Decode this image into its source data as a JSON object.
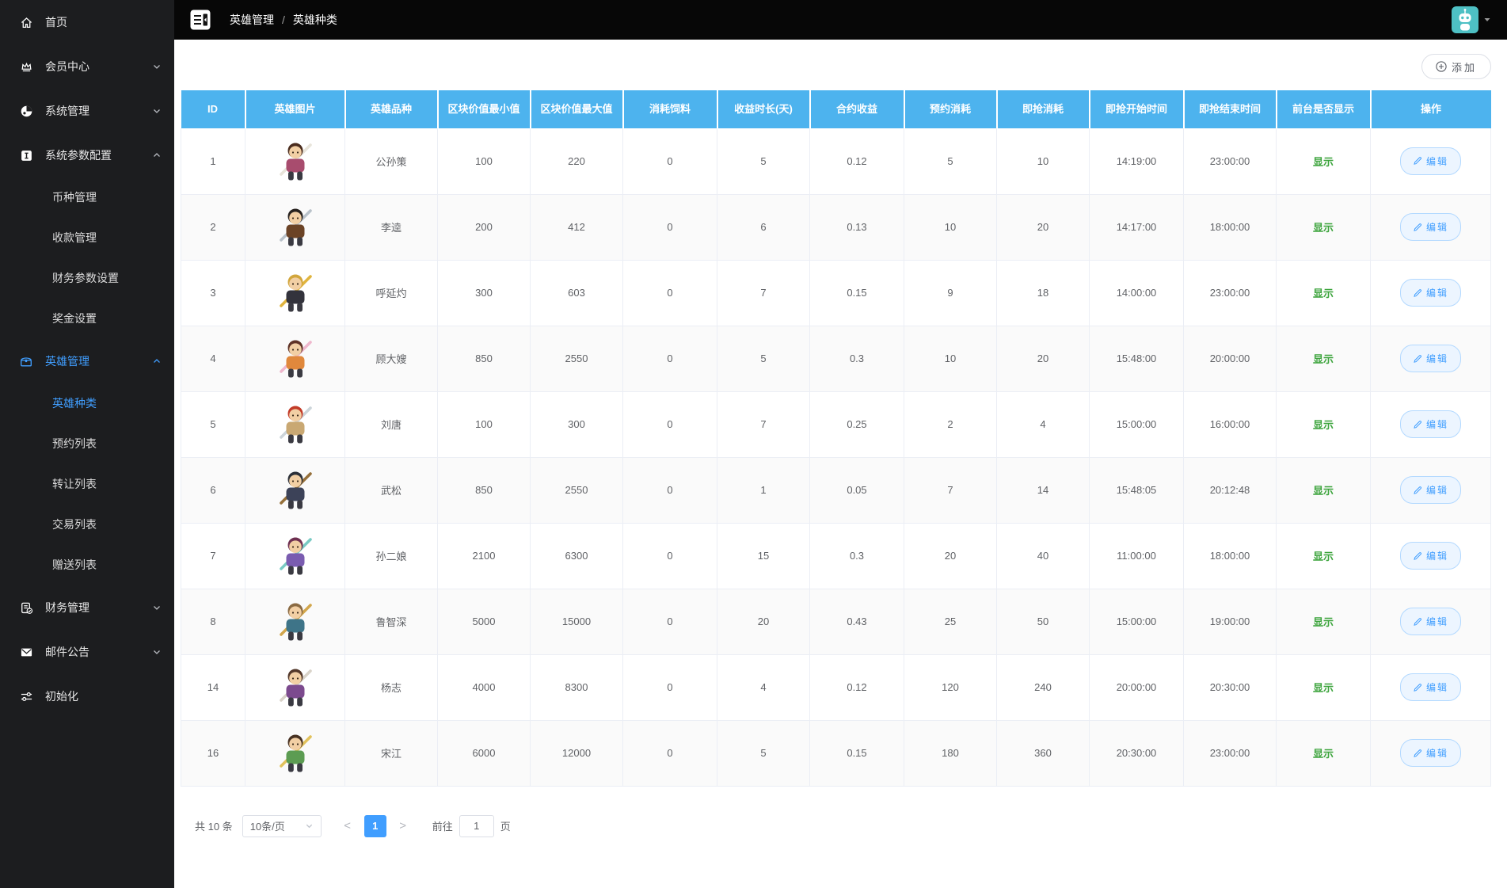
{
  "colors": {
    "accent": "#409EFF",
    "table_header_blue": "#4db3ee",
    "success_green": "#3aa33a",
    "sidebar_bg": "#1c1d1f",
    "topbar_bg": "#070707",
    "avatar_teal": "#4ec0c4",
    "edit_btn_bg": "#ecf5ff",
    "edit_btn_border": "#b3d9ff"
  },
  "sidebar": {
    "items": [
      {
        "label": "首页",
        "icon": "home-icon"
      },
      {
        "label": "会员中心",
        "icon": "crown-icon",
        "chevron": "down"
      },
      {
        "label": "系统管理",
        "icon": "globe-icon",
        "chevron": "down"
      },
      {
        "label": "系统参数配置",
        "icon": "info-square-icon",
        "chevron": "up",
        "children": [
          {
            "label": "币种管理"
          },
          {
            "label": "收款管理"
          },
          {
            "label": "财务参数设置"
          },
          {
            "label": "奖金设置"
          }
        ]
      },
      {
        "label": "英雄管理",
        "icon": "chest-icon",
        "chevron": "up",
        "active": true,
        "children": [
          {
            "label": "英雄种类",
            "active": true
          },
          {
            "label": "预约列表"
          },
          {
            "label": "转让列表"
          },
          {
            "label": "交易列表"
          },
          {
            "label": "赠送列表"
          }
        ]
      },
      {
        "label": "财务管理",
        "icon": "finance-doc-icon",
        "chevron": "down"
      },
      {
        "label": "邮件公告",
        "icon": "mail-icon",
        "chevron": "down"
      },
      {
        "label": "初始化",
        "icon": "sliders-icon"
      }
    ]
  },
  "topbar": {
    "breadcrumb": [
      {
        "label": "英雄管理"
      },
      {
        "label": "英雄种类"
      }
    ],
    "separator": "/",
    "icons": [
      "menu-collapse-icon",
      "avatar",
      "caret-down-icon"
    ]
  },
  "toolbar": {
    "add_label": "添加",
    "add_icon": "plus-circle-icon"
  },
  "table": {
    "headers": [
      "ID",
      "英雄图片",
      "英雄品种",
      "区块价值最小值",
      "区块价值最大值",
      "消耗饲料",
      "收益时长(天)",
      "合约收益",
      "预约消耗",
      "即抢消耗",
      "即抢开始时间",
      "即抢结束时间",
      "前台是否显示",
      "操作"
    ],
    "labels": {
      "edit": "编辑",
      "edit_icon": "pencil-icon",
      "sprite_icon": "hero-sprite"
    },
    "rows": [
      {
        "id": 1,
        "name": "公孙策",
        "min": 100,
        "max": 220,
        "feed": 0,
        "days": 5,
        "profit": "0.12",
        "reserve": 5,
        "grab": 10,
        "start": "14:19:00",
        "end": "23:00:00",
        "visible": "显示",
        "sprite": {
          "hair": "#4a2c1e",
          "body": "#a84c6e",
          "weapon": "#e8e4da"
        }
      },
      {
        "id": 2,
        "name": "李逵",
        "min": 200,
        "max": 412,
        "feed": 0,
        "days": 6,
        "profit": "0.13",
        "reserve": 10,
        "grab": 20,
        "start": "14:17:00",
        "end": "18:00:00",
        "visible": "显示",
        "sprite": {
          "hair": "#26211e",
          "body": "#6b4326",
          "weapon": "#b9c2ca"
        }
      },
      {
        "id": 3,
        "name": "呼延灼",
        "min": 300,
        "max": 603,
        "feed": 0,
        "days": 7,
        "profit": "0.15",
        "reserve": 9,
        "grab": 18,
        "start": "14:00:00",
        "end": "23:00:00",
        "visible": "显示",
        "sprite": {
          "hair": "#d2a63c",
          "body": "#33333c",
          "weapon": "#e0b43e"
        }
      },
      {
        "id": 4,
        "name": "顾大嫂",
        "min": 850,
        "max": 2550,
        "feed": 0,
        "days": 5,
        "profit": "0.3",
        "reserve": 10,
        "grab": 20,
        "start": "15:48:00",
        "end": "20:00:00",
        "visible": "显示",
        "sprite": {
          "hair": "#5e3226",
          "body": "#e0883c",
          "weapon": "#efb7cd"
        }
      },
      {
        "id": 5,
        "name": "刘唐",
        "min": 100,
        "max": 300,
        "feed": 0,
        "days": 7,
        "profit": "0.25",
        "reserve": 2,
        "grab": 4,
        "start": "15:00:00",
        "end": "16:00:00",
        "visible": "显示",
        "sprite": {
          "hair": "#c23b28",
          "body": "#c9a873",
          "weapon": "#ccd4d9"
        }
      },
      {
        "id": 6,
        "name": "武松",
        "min": 850,
        "max": 2550,
        "feed": 0,
        "days": 1,
        "profit": "0.05",
        "reserve": 7,
        "grab": 14,
        "start": "15:48:05",
        "end": "20:12:48",
        "visible": "显示",
        "sprite": {
          "hair": "#2c3038",
          "body": "#3c4258",
          "weapon": "#96703a"
        }
      },
      {
        "id": 7,
        "name": "孙二娘",
        "min": 2100,
        "max": 6300,
        "feed": 0,
        "days": 15,
        "profit": "0.3",
        "reserve": 20,
        "grab": 40,
        "start": "11:00:00",
        "end": "18:00:00",
        "visible": "显示",
        "sprite": {
          "hair": "#6e2f50",
          "body": "#7a5cb0",
          "weapon": "#79cbc4"
        }
      },
      {
        "id": 8,
        "name": "鲁智深",
        "min": 5000,
        "max": 15000,
        "feed": 0,
        "days": 20,
        "profit": "0.43",
        "reserve": 25,
        "grab": 50,
        "start": "15:00:00",
        "end": "19:00:00",
        "visible": "显示",
        "sprite": {
          "hair": "#8a6a42",
          "body": "#3e7488",
          "weapon": "#d2a64c"
        }
      },
      {
        "id": 14,
        "name": "杨志",
        "min": 4000,
        "max": 8300,
        "feed": 0,
        "days": 4,
        "profit": "0.12",
        "reserve": 120,
        "grab": 240,
        "start": "20:00:00",
        "end": "20:30:00",
        "visible": "显示",
        "sprite": {
          "hair": "#53382a",
          "body": "#7c4a8e",
          "weapon": "#d9d3c9"
        }
      },
      {
        "id": 16,
        "name": "宋江",
        "min": 6000,
        "max": 12000,
        "feed": 0,
        "days": 5,
        "profit": "0.15",
        "reserve": 180,
        "grab": 360,
        "start": "20:30:00",
        "end": "23:00:00",
        "visible": "显示",
        "sprite": {
          "hair": "#473122",
          "body": "#5c9c52",
          "weapon": "#e2c25c"
        }
      }
    ]
  },
  "pagination": {
    "total": "共 10 条",
    "page_size": "10条/页",
    "prev": "<",
    "page": "1",
    "next": ">",
    "goto": "前往",
    "goto_value": "1",
    "unit": "页"
  }
}
